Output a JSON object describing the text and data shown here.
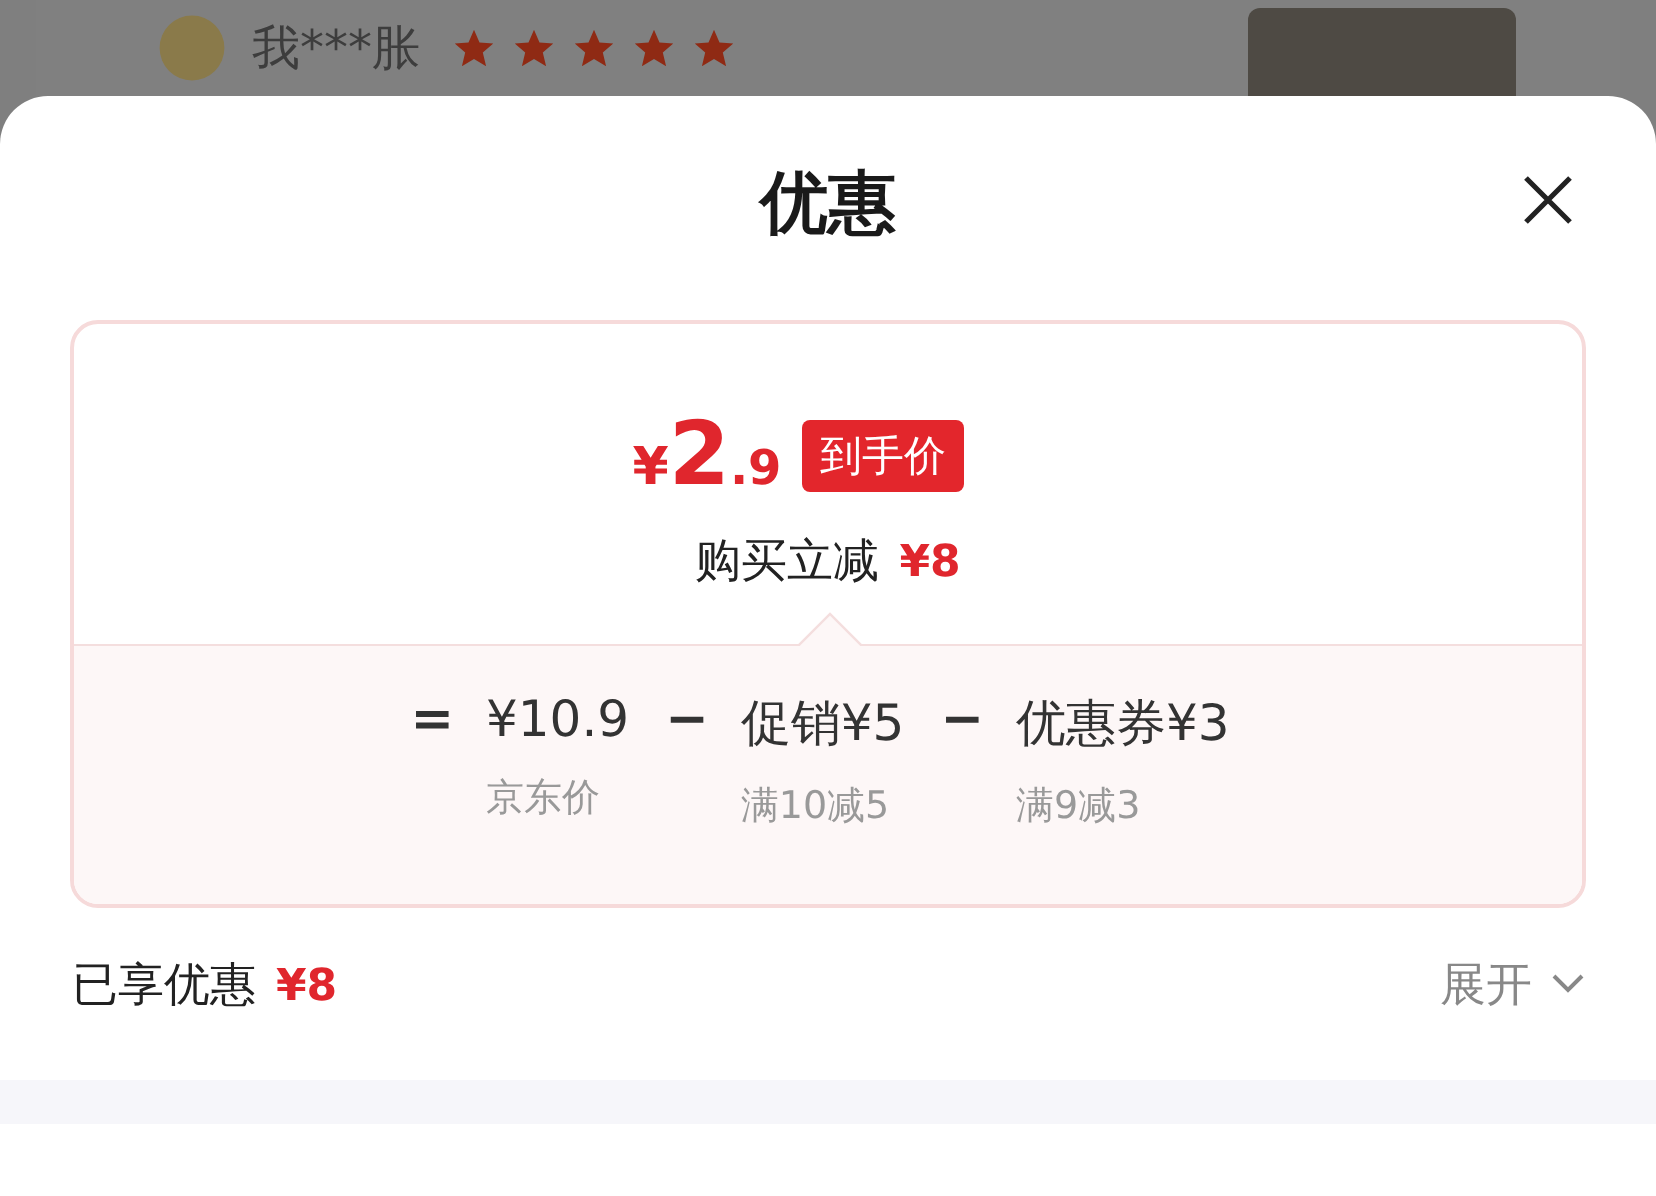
{
  "background": {
    "reviewer": {
      "name": "我***胀",
      "stars": 5
    }
  },
  "sheet": {
    "title": "优惠",
    "price": {
      "currency": "¥",
      "integer": "2",
      "decimal": ".9",
      "tag": "到手价"
    },
    "discount": {
      "label": "购买立减",
      "amount": "¥8"
    },
    "breakdown": [
      {
        "operator": "=",
        "amount": "¥10.9",
        "note": "京东价"
      },
      {
        "operator": "−",
        "amount": "促销¥5",
        "note": "满10减5"
      },
      {
        "operator": "−",
        "amount": "优惠券¥3",
        "note": "满9减3"
      }
    ],
    "summary": {
      "label": "已享优惠",
      "amount": "¥8",
      "toggle": "展开"
    }
  }
}
